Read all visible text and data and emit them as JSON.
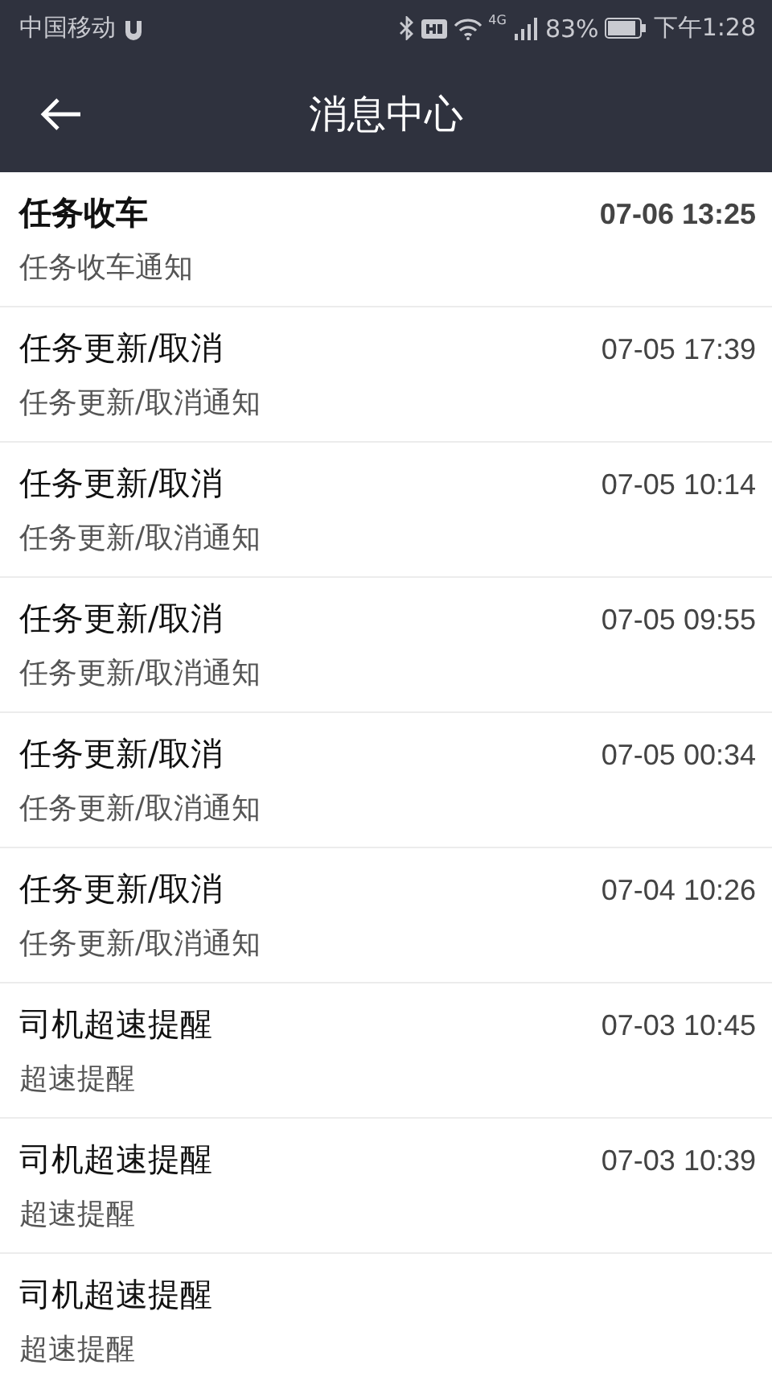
{
  "status_bar": {
    "carrier": "中国移动",
    "network": "4G",
    "battery": "83%",
    "time": "下午1:28"
  },
  "header": {
    "title": "消息中心"
  },
  "messages": [
    {
      "title": "任务收车",
      "subtitle": "任务收车通知",
      "time": "07-06 13:25",
      "unread": true
    },
    {
      "title": "任务更新/取消",
      "subtitle": "任务更新/取消通知",
      "time": "07-05 17:39",
      "unread": false
    },
    {
      "title": "任务更新/取消",
      "subtitle": "任务更新/取消通知",
      "time": "07-05 10:14",
      "unread": false
    },
    {
      "title": "任务更新/取消",
      "subtitle": "任务更新/取消通知",
      "time": "07-05 09:55",
      "unread": false
    },
    {
      "title": "任务更新/取消",
      "subtitle": "任务更新/取消通知",
      "time": "07-05 00:34",
      "unread": false
    },
    {
      "title": "任务更新/取消",
      "subtitle": "任务更新/取消通知",
      "time": "07-04 10:26",
      "unread": false
    },
    {
      "title": "司机超速提醒",
      "subtitle": "超速提醒",
      "time": "07-03 10:45",
      "unread": false
    },
    {
      "title": "司机超速提醒",
      "subtitle": "超速提醒",
      "time": "07-03 10:39",
      "unread": false
    },
    {
      "title": "司机超速提醒",
      "subtitle": "超速提醒",
      "unread": false
    }
  ]
}
